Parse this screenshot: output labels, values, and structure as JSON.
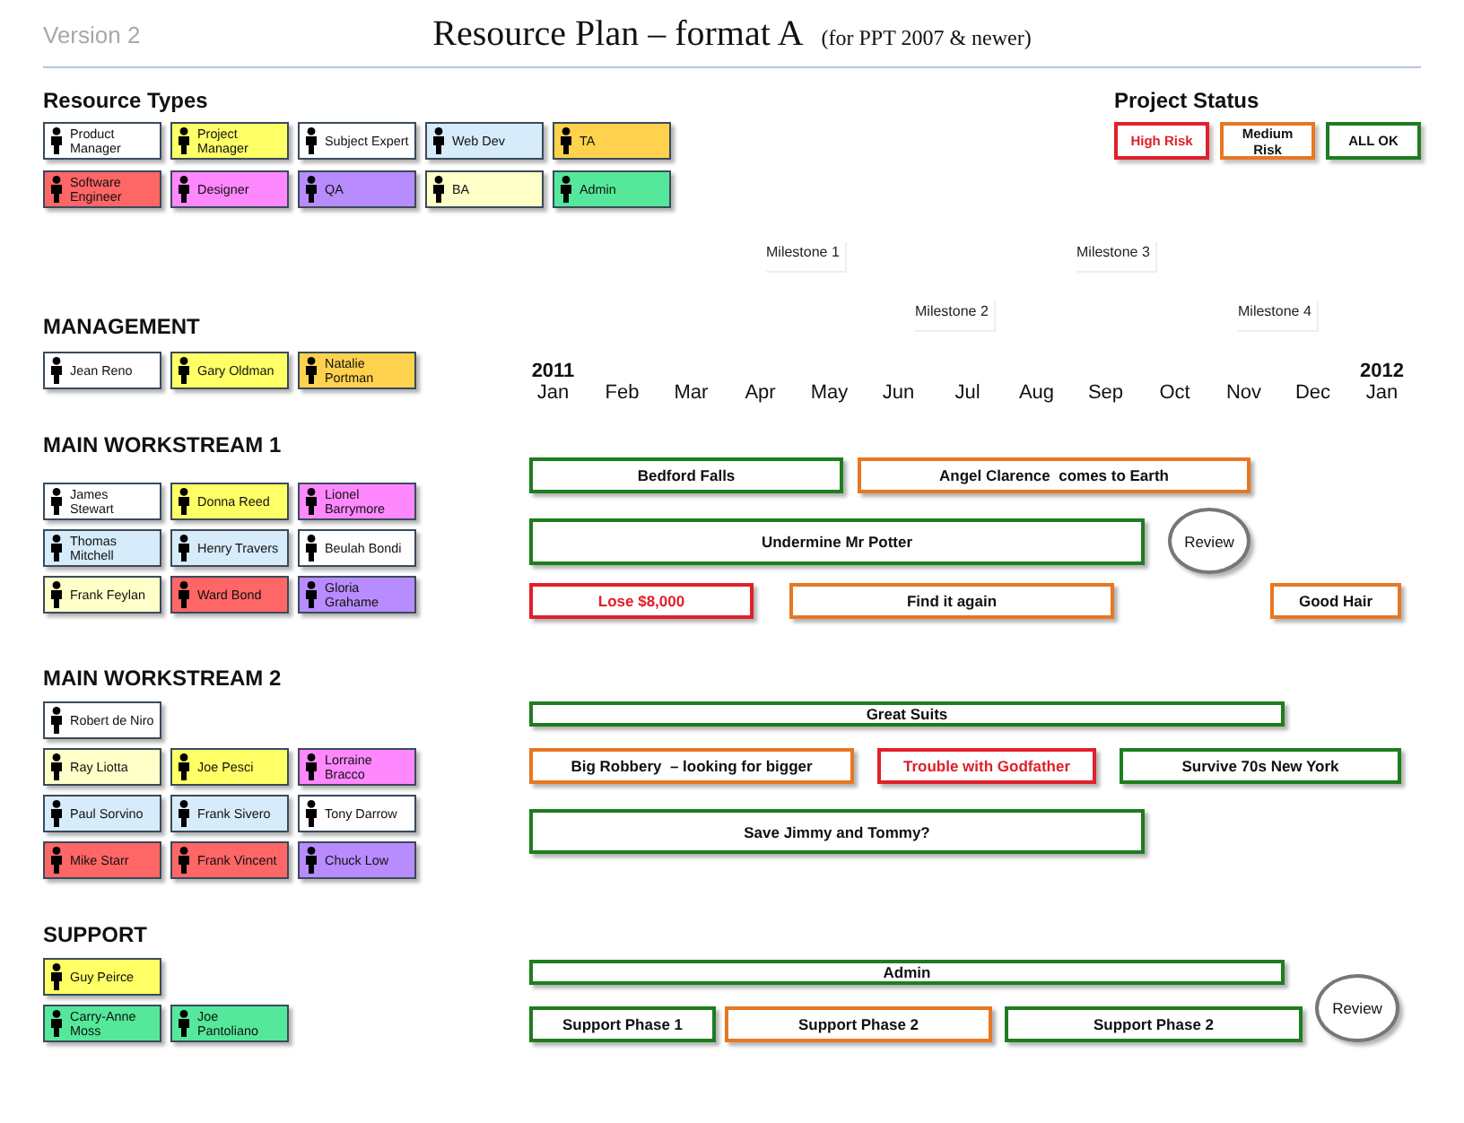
{
  "version_label": "Version 2",
  "title": "Resource Plan – format A",
  "subtitle": "(for PPT 2007 & newer)",
  "resource_types": {
    "heading": "Resource Types",
    "rows": [
      [
        {
          "label": "Product Manager",
          "color": "#ffffff"
        },
        {
          "label": "Project Manager",
          "color": "#ffff66"
        },
        {
          "label": "Subject Expert",
          "color": "#ffffff"
        },
        {
          "label": "Web Dev",
          "color": "#d6ecfa"
        },
        {
          "label": "TA",
          "color": "#ffd24d"
        }
      ],
      [
        {
          "label": "Software Engineer",
          "color": "#ff6666"
        },
        {
          "label": "Designer",
          "color": "#ff88ff"
        },
        {
          "label": "QA",
          "color": "#b88cff"
        },
        {
          "label": "BA",
          "color": "#ffffc8"
        },
        {
          "label": "Admin",
          "color": "#55e89a"
        }
      ]
    ]
  },
  "project_status": {
    "heading": "Project Status",
    "items": [
      {
        "label": "High Risk",
        "color": "#e0202a"
      },
      {
        "label": "Medium Risk",
        "color": "#e87722"
      },
      {
        "label": "ALL OK",
        "color": "#1e7d1e"
      }
    ]
  },
  "timeline": {
    "years": [
      "2011",
      "2012"
    ],
    "months": [
      "Jan",
      "Feb",
      "Mar",
      "Apr",
      "May",
      "Jun",
      "Jul",
      "Aug",
      "Sep",
      "Oct",
      "Nov",
      "Dec",
      "Jan"
    ],
    "milestones": [
      "Milestone 1",
      "Milestone 2",
      "Milestone 3",
      "Milestone 4"
    ]
  },
  "sections": [
    {
      "heading": "MANAGEMENT",
      "people": [
        [
          {
            "label": "Jean Reno",
            "color": "#ffffff"
          },
          {
            "label": "Gary Oldman",
            "color": "#ffff66"
          },
          {
            "label": "Natalie Portman",
            "color": "#ffd24d"
          }
        ]
      ]
    },
    {
      "heading": "MAIN WORKSTREAM  1",
      "people": [
        [
          {
            "label": "James Stewart",
            "color": "#ffffff"
          },
          {
            "label": "Donna Reed",
            "color": "#ffff66"
          },
          {
            "label": "Lionel Barrymore",
            "color": "#ff88ff"
          }
        ],
        [
          {
            "label": "Thomas Mitchell",
            "color": "#d6ecfa"
          },
          {
            "label": "Henry Travers",
            "color": "#d6ecfa"
          },
          {
            "label": "Beulah Bondi",
            "color": "#ffffff"
          }
        ],
        [
          {
            "label": "Frank Feylan",
            "color": "#ffffc8"
          },
          {
            "label": "Ward Bond",
            "color": "#ff6666"
          },
          {
            "label": "Gloria Grahame",
            "color": "#b88cff"
          }
        ]
      ],
      "tasks": [
        [
          {
            "kind": "task",
            "label": "Bedford Falls",
            "color": "#1e7d1e"
          },
          {
            "kind": "task",
            "label": "Angel Clarence  comes to Earth",
            "color": "#e87722"
          }
        ],
        [
          {
            "kind": "task",
            "label": "Undermine Mr Potter",
            "color": "#1e7d1e"
          },
          {
            "kind": "review",
            "label": "Review"
          }
        ],
        [
          {
            "kind": "task",
            "label": "Lose $8,000",
            "color": "#e0202a"
          },
          {
            "kind": "task",
            "label": "Find it again",
            "color": "#e87722"
          },
          {
            "kind": "task",
            "label": "Good Hair",
            "color": "#e87722"
          }
        ]
      ]
    },
    {
      "heading": "MAIN WORKSTREAM  2",
      "people": [
        [
          {
            "label": "Robert de Niro",
            "color": "#ffffff"
          }
        ],
        [
          {
            "label": "Ray Liotta",
            "color": "#ffffc8"
          },
          {
            "label": "Joe Pesci",
            "color": "#ffff66"
          },
          {
            "label": "Lorraine Bracco",
            "color": "#ff88ff"
          }
        ],
        [
          {
            "label": "Paul Sorvino",
            "color": "#d6ecfa"
          },
          {
            "label": "Frank Sivero",
            "color": "#d6ecfa"
          },
          {
            "label": "Tony Darrow",
            "color": "#ffffff"
          }
        ],
        [
          {
            "label": "Mike Starr",
            "color": "#ff6666"
          },
          {
            "label": "Frank Vincent",
            "color": "#ff6666"
          },
          {
            "label": "Chuck Low",
            "color": "#b88cff"
          }
        ]
      ],
      "tasks": [
        [
          {
            "kind": "task",
            "label": "Great Suits",
            "color": "#1e7d1e"
          }
        ],
        [
          {
            "kind": "task",
            "label": "Big Robbery  – looking for bigger",
            "color": "#e87722"
          },
          {
            "kind": "task",
            "label": "Trouble with Godfather",
            "color": "#e0202a"
          },
          {
            "kind": "task",
            "label": "Survive 70s New York",
            "color": "#1e7d1e"
          }
        ],
        [
          {
            "kind": "task",
            "label": "Save Jimmy and Tommy?",
            "color": "#1e7d1e"
          }
        ]
      ]
    },
    {
      "heading": "SUPPORT",
      "people": [
        [
          {
            "label": "Guy Peirce",
            "color": "#ffff66"
          }
        ],
        [
          {
            "label": "Carry-Anne Moss",
            "color": "#55e89a"
          },
          {
            "label": "Joe Pantoliano",
            "color": "#55e89a"
          }
        ]
      ],
      "tasks": [
        [
          {
            "kind": "task",
            "label": "Admin",
            "color": "#1e7d1e"
          }
        ],
        [
          {
            "kind": "task",
            "label": "Support Phase 1",
            "color": "#1e7d1e"
          },
          {
            "kind": "task",
            "label": "Support Phase 2",
            "color": "#e87722"
          },
          {
            "kind": "task",
            "label": "Support Phase 2",
            "color": "#1e7d1e"
          },
          {
            "kind": "review",
            "label": "Review"
          }
        ]
      ]
    }
  ]
}
